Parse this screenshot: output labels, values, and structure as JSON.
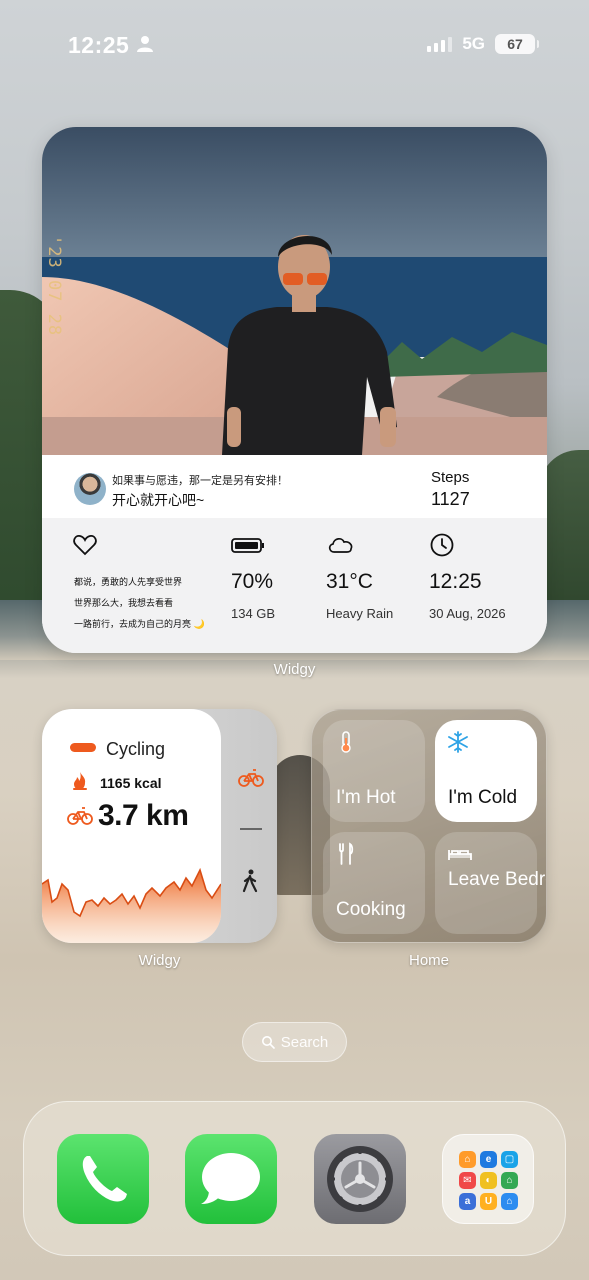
{
  "status_bar": {
    "time": "12:25",
    "network": "5G",
    "battery": "67",
    "icons": [
      "person-icon",
      "signal-icon",
      "battery-icon"
    ]
  },
  "photo_widget": {
    "photo_stamp": "'23 07 28",
    "quote_line1": "如果事与愿违，那一定是另有安排！",
    "quote_line2": "开心就开心吧~",
    "steps_label": "Steps",
    "steps_value": "1127",
    "heart_lines": [
      "都说，勇敢的人先享受世界",
      "世界那么大，我想去看看",
      "一路前行，去成为自己的月亮 🌙"
    ],
    "battery_value": "70%",
    "battery_sub": "134 GB",
    "weather_value": "31°C",
    "weather_sub": "Heavy Rain",
    "clock_value": "12:25",
    "clock_sub": "30 Aug, 2026",
    "caption": "Widgy"
  },
  "cycling_widget": {
    "title": "Cycling",
    "kcal": "1165 kcal",
    "distance": "3.7 km",
    "caption": "Widgy",
    "accent": "#ee5a1e"
  },
  "home_widget": {
    "caption": "Home",
    "scenes": [
      {
        "label": "I'm Hot",
        "icon": "thermometer-icon",
        "active": false
      },
      {
        "label": "I'm Cold",
        "icon": "snowflake-icon",
        "active": true
      },
      {
        "label": "Cooking",
        "icon": "fork-knife-icon",
        "active": false
      },
      {
        "label": "Leave Bedro...",
        "icon": "bed-icon",
        "active": false
      }
    ]
  },
  "search": {
    "label": "Search"
  },
  "dock": {
    "apps": [
      "Phone",
      "Messages",
      "Settings",
      "Folder"
    ]
  }
}
